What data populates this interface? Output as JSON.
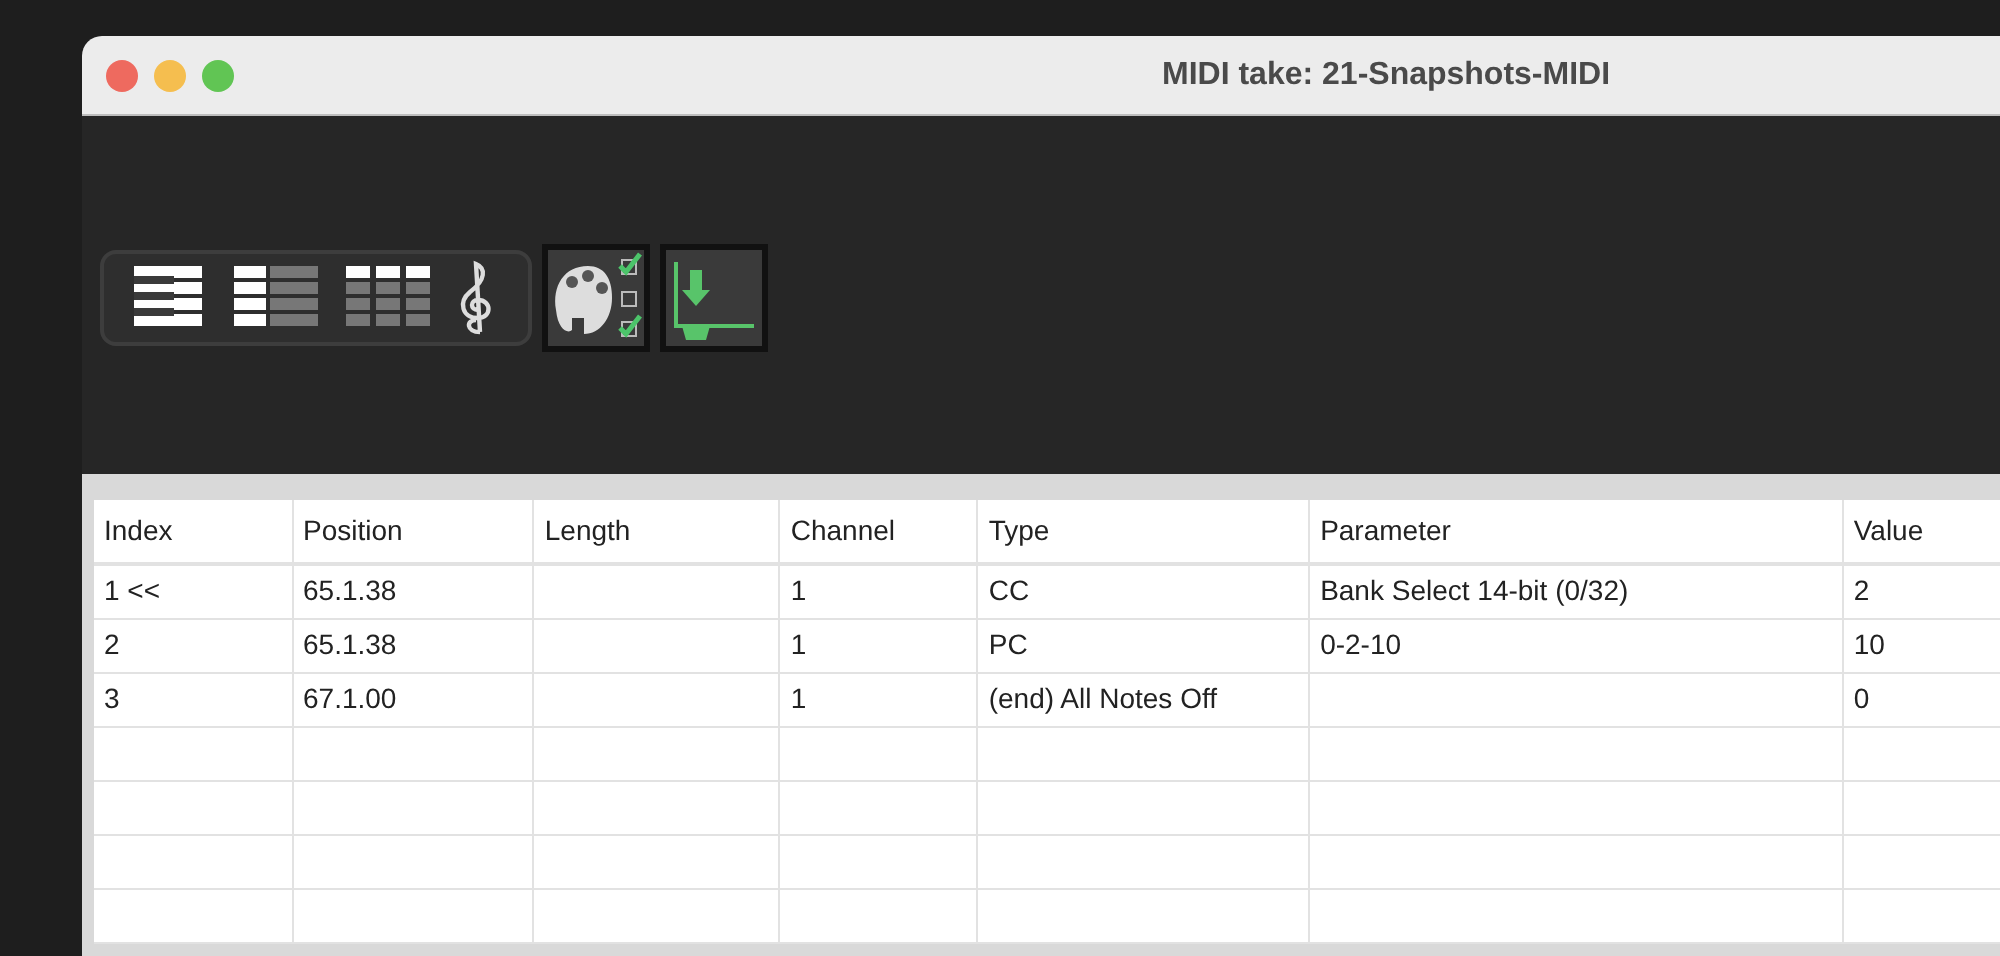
{
  "window": {
    "title": "MIDI take: 21-Snapshots-MIDI"
  },
  "table": {
    "columns": [
      "Index",
      "Position",
      "Length",
      "Channel",
      "Type",
      "Parameter",
      "Value"
    ],
    "rows": [
      [
        "1 <<",
        "65.1.38",
        "",
        "1",
        "CC",
        "Bank Select 14-bit (0/32)",
        "2"
      ],
      [
        "2",
        "65.1.38",
        "",
        "1",
        "PC",
        "0-2-10",
        "10"
      ],
      [
        "3",
        "67.1.00",
        "",
        "1",
        "(end) All Notes Off",
        "",
        "0"
      ]
    ]
  }
}
